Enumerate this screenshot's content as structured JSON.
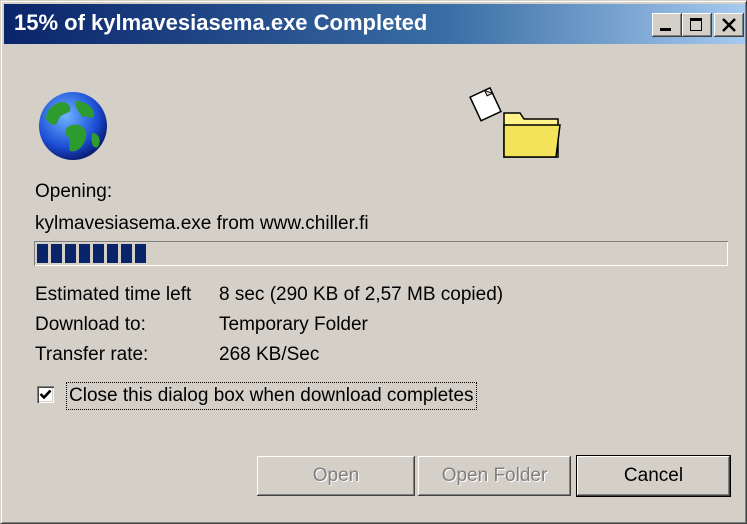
{
  "window": {
    "title": "15% of kylmavesiasema.exe Completed",
    "controls": {
      "minimize": "minimize-icon",
      "maximize": "maximize-icon",
      "close": "close-icon"
    }
  },
  "icons": {
    "globe": "globe-icon",
    "folder": "folder-icon"
  },
  "status": {
    "opening_label": "Opening:",
    "source": "kylmavesiasema.exe from www.chiller.fi",
    "progress_percent": 15,
    "progress_segments_shown": 8
  },
  "details": {
    "time_left_label": "Estimated time left",
    "time_left_value": "8 sec (290 KB of 2,57 MB copied)",
    "download_to_label": "Download to:",
    "download_to_value": "Temporary Folder",
    "transfer_rate_label": "Transfer rate:",
    "transfer_rate_value": "268 KB/Sec"
  },
  "options": {
    "close_on_complete_label": "Close this dialog box when download completes",
    "close_on_complete_checked": true
  },
  "buttons": {
    "open": "Open",
    "open_folder": "Open Folder",
    "cancel": "Cancel"
  },
  "colors": {
    "progress": "#0a246a",
    "titlebar_start": "#0a246a",
    "titlebar_end": "#a6caf0"
  }
}
